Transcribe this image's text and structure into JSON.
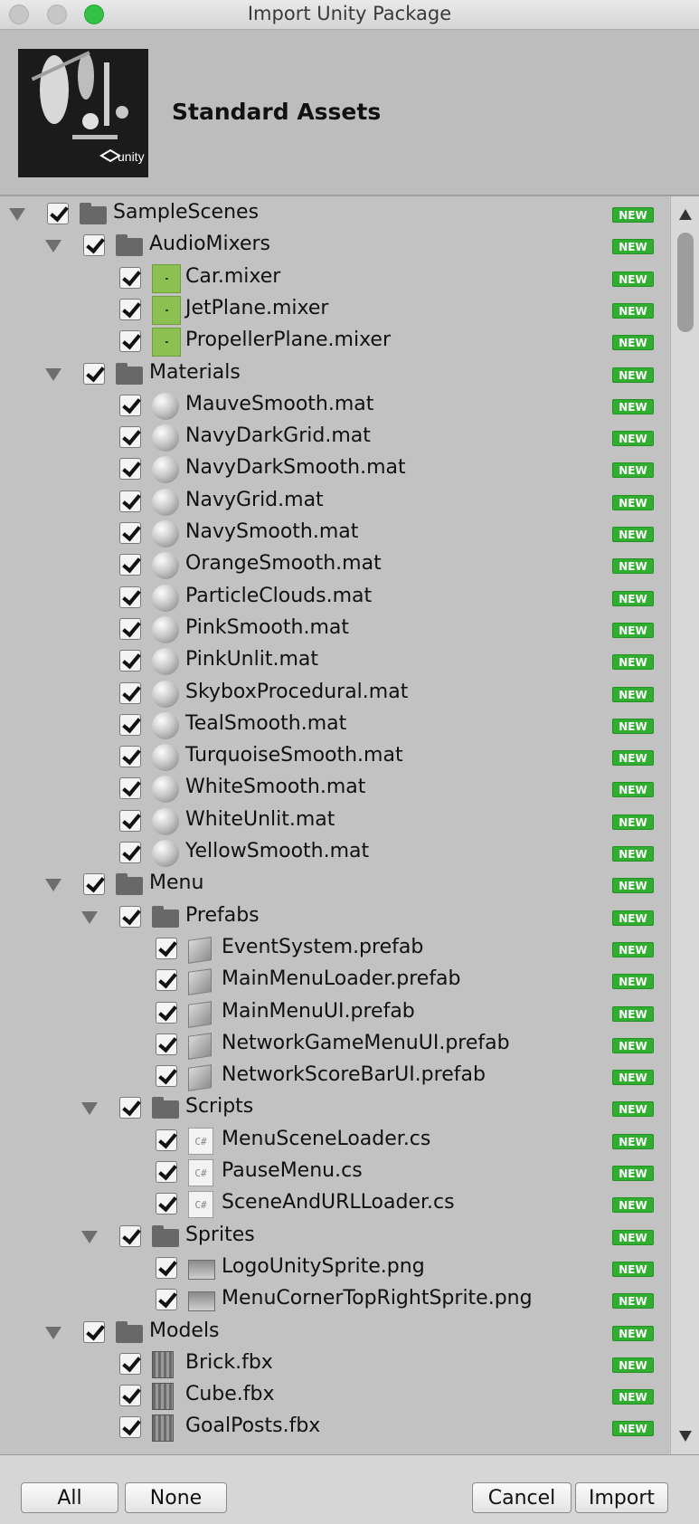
{
  "window": {
    "title": "Import Unity Package"
  },
  "package": {
    "name": "Standard Assets",
    "icon_label": "unity"
  },
  "badge": "NEW",
  "tree": [
    {
      "indent": 0,
      "expand": true,
      "icon": "folder",
      "label": "SampleScenes"
    },
    {
      "indent": 1,
      "expand": true,
      "icon": "folder",
      "label": "AudioMixers"
    },
    {
      "indent": 2,
      "expand": false,
      "icon": "mixer",
      "label": "Car.mixer"
    },
    {
      "indent": 2,
      "expand": false,
      "icon": "mixer",
      "label": "JetPlane.mixer"
    },
    {
      "indent": 2,
      "expand": false,
      "icon": "mixer",
      "label": "PropellerPlane.mixer"
    },
    {
      "indent": 1,
      "expand": true,
      "icon": "folder",
      "label": "Materials"
    },
    {
      "indent": 2,
      "expand": false,
      "icon": "sphere",
      "label": "MauveSmooth.mat"
    },
    {
      "indent": 2,
      "expand": false,
      "icon": "sphere",
      "label": "NavyDarkGrid.mat"
    },
    {
      "indent": 2,
      "expand": false,
      "icon": "sphere",
      "label": "NavyDarkSmooth.mat"
    },
    {
      "indent": 2,
      "expand": false,
      "icon": "sphere",
      "label": "NavyGrid.mat"
    },
    {
      "indent": 2,
      "expand": false,
      "icon": "sphere",
      "label": "NavySmooth.mat"
    },
    {
      "indent": 2,
      "expand": false,
      "icon": "sphere",
      "label": "OrangeSmooth.mat"
    },
    {
      "indent": 2,
      "expand": false,
      "icon": "sphere",
      "label": "ParticleClouds.mat"
    },
    {
      "indent": 2,
      "expand": false,
      "icon": "sphere",
      "label": "PinkSmooth.mat"
    },
    {
      "indent": 2,
      "expand": false,
      "icon": "sphere",
      "label": "PinkUnlit.mat"
    },
    {
      "indent": 2,
      "expand": false,
      "icon": "sphere",
      "label": "SkyboxProcedural.mat"
    },
    {
      "indent": 2,
      "expand": false,
      "icon": "sphere",
      "label": "TealSmooth.mat"
    },
    {
      "indent": 2,
      "expand": false,
      "icon": "sphere",
      "label": "TurquoiseSmooth.mat"
    },
    {
      "indent": 2,
      "expand": false,
      "icon": "sphere",
      "label": "WhiteSmooth.mat"
    },
    {
      "indent": 2,
      "expand": false,
      "icon": "sphere",
      "label": "WhiteUnlit.mat"
    },
    {
      "indent": 2,
      "expand": false,
      "icon": "sphere",
      "label": "YellowSmooth.mat"
    },
    {
      "indent": 1,
      "expand": true,
      "icon": "folder",
      "label": "Menu"
    },
    {
      "indent": 2,
      "expand": true,
      "icon": "folder",
      "label": "Prefabs"
    },
    {
      "indent": 3,
      "expand": false,
      "icon": "cube",
      "label": "EventSystem.prefab"
    },
    {
      "indent": 3,
      "expand": false,
      "icon": "cube",
      "label": "MainMenuLoader.prefab"
    },
    {
      "indent": 3,
      "expand": false,
      "icon": "cube",
      "label": "MainMenuUI.prefab"
    },
    {
      "indent": 3,
      "expand": false,
      "icon": "cube",
      "label": "NetworkGameMenuUI.prefab"
    },
    {
      "indent": 3,
      "expand": false,
      "icon": "cube",
      "label": "NetworkScoreBarUI.prefab"
    },
    {
      "indent": 2,
      "expand": true,
      "icon": "folder",
      "label": "Scripts"
    },
    {
      "indent": 3,
      "expand": false,
      "icon": "script",
      "label": "MenuSceneLoader.cs"
    },
    {
      "indent": 3,
      "expand": false,
      "icon": "script",
      "label": "PauseMenu.cs"
    },
    {
      "indent": 3,
      "expand": false,
      "icon": "script",
      "label": "SceneAndURLLoader.cs"
    },
    {
      "indent": 2,
      "expand": true,
      "icon": "folder",
      "label": "Sprites"
    },
    {
      "indent": 3,
      "expand": false,
      "icon": "sprite",
      "label": "LogoUnitySprite.png"
    },
    {
      "indent": 3,
      "expand": false,
      "icon": "sprite",
      "label": "MenuCornerTopRightSprite.png"
    },
    {
      "indent": 1,
      "expand": true,
      "icon": "folder",
      "label": "Models"
    },
    {
      "indent": 2,
      "expand": false,
      "icon": "mesh",
      "label": "Brick.fbx"
    },
    {
      "indent": 2,
      "expand": false,
      "icon": "mesh",
      "label": "Cube.fbx"
    },
    {
      "indent": 2,
      "expand": false,
      "icon": "mesh",
      "label": "GoalPosts.fbx"
    }
  ],
  "script_icon_text": "C#",
  "buttons": {
    "all": "All",
    "none": "None",
    "cancel": "Cancel",
    "import": "Import"
  }
}
